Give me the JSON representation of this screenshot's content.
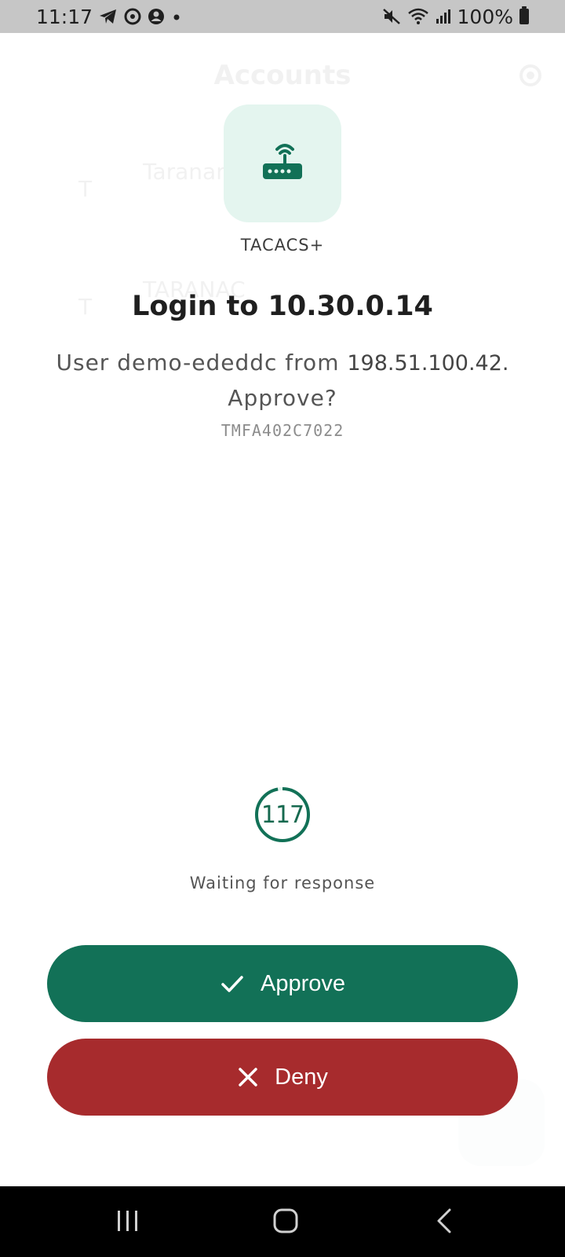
{
  "status_bar": {
    "time": "11:17",
    "battery": "100%"
  },
  "background": {
    "title": "Accounts",
    "rows": [
      {
        "name": "Taranar",
        "sub": ""
      },
      {
        "name": "TARANAC",
        "sub": ""
      }
    ]
  },
  "request": {
    "app_name": "TACACS+",
    "title": "Login to 10.30.0.14",
    "message_prefix": "User demo-ededdc from",
    "ip": "198.51.100.42.",
    "question": "Approve?",
    "code": "TMFA402C7022"
  },
  "timer": {
    "seconds": "117",
    "status": "Waiting for response",
    "fraction_remaining": 0.97
  },
  "actions": {
    "approve_label": "Approve",
    "deny_label": "Deny"
  },
  "colors": {
    "primary": "#127157",
    "danger": "#a72b2d",
    "tile": "#e4f5ef"
  },
  "icons": {
    "app": "router-icon",
    "approve": "check-icon",
    "deny": "close-icon"
  }
}
